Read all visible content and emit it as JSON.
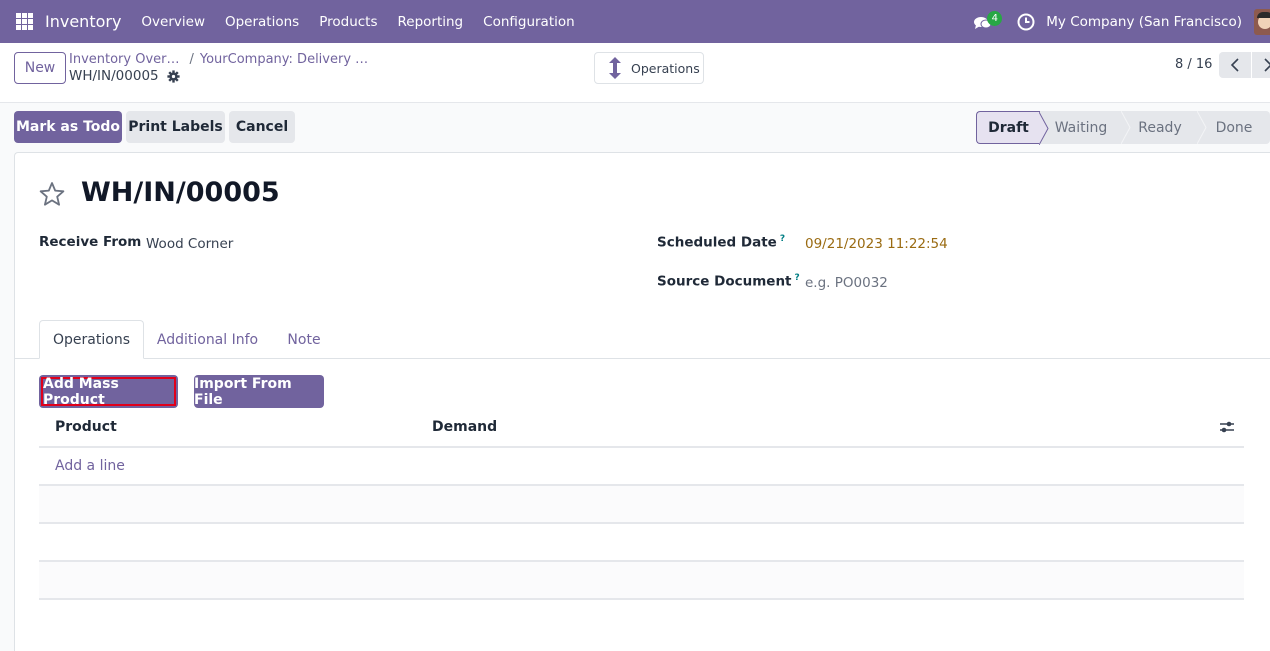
{
  "navbar": {
    "app_name": "Inventory",
    "menu": [
      "Overview",
      "Operations",
      "Products",
      "Reporting",
      "Configuration"
    ],
    "chat_count": "4",
    "company": "My Company (San Francisco)",
    "icons": {
      "apps": "apps-grid-icon",
      "chat": "chat-icon",
      "activity": "clock-icon",
      "user": "avatar"
    }
  },
  "control_panel": {
    "new_label": "New",
    "breadcrumbs": [
      "Inventory Over…",
      "YourCompany: Delivery …"
    ],
    "record_name": "WH/IN/00005",
    "smart_button": "Operations",
    "pager": "8 / 16"
  },
  "actions": {
    "mark_todo": "Mark as Todo",
    "print_labels": "Print Labels",
    "cancel": "Cancel"
  },
  "statusbar": {
    "stages": [
      "Draft",
      "Waiting",
      "Ready",
      "Done"
    ],
    "current": "Draft"
  },
  "form": {
    "title": "WH/IN/00005",
    "fields": {
      "receive_from": {
        "label": "Receive From",
        "value": "Wood Corner"
      },
      "scheduled_date": {
        "label": "Scheduled Date",
        "help": "?",
        "value": "09/21/2023 11:22:54"
      },
      "source_document": {
        "label": "Source Document",
        "help": "?",
        "placeholder": "e.g. PO0032"
      }
    },
    "tabs": [
      "Operations",
      "Additional Info",
      "Note"
    ],
    "active_tab": "Operations",
    "buttons": {
      "add_mass": "Add Mass Product",
      "import": "Import From File"
    },
    "table": {
      "columns": [
        "Product",
        "Demand"
      ],
      "add_line": "Add a line",
      "rows": []
    }
  },
  "colors": {
    "brand": "#71639e",
    "date": "#9a6b12",
    "highlight": "#e0001b",
    "badge": "#28a745"
  }
}
